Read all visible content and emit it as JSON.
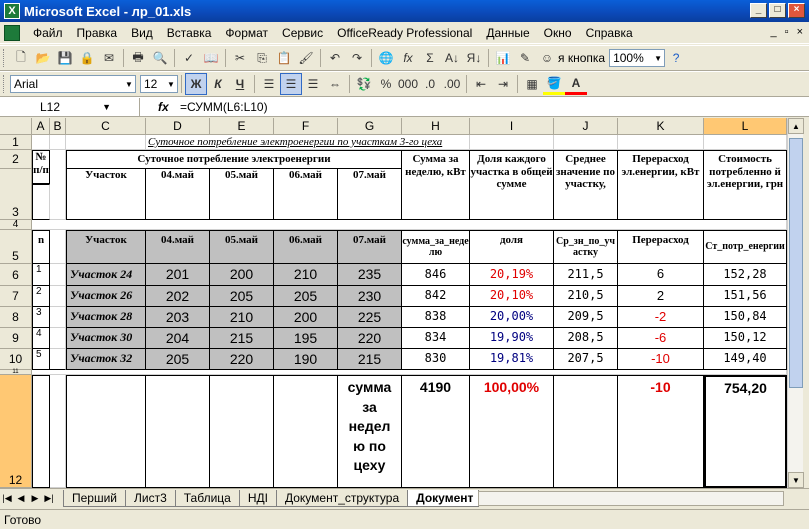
{
  "window": {
    "title": "Microsoft Excel - лр_01.xls"
  },
  "menu": [
    "Файл",
    "Правка",
    "Вид",
    "Вставка",
    "Формат",
    "Сервис",
    "OfficeReady Professional",
    "Данные",
    "Окно",
    "Справка"
  ],
  "toolbar": {
    "smile_label": "я кнопка",
    "zoom": "100%"
  },
  "format_bar": {
    "font": "Arial",
    "size": "12",
    "bold": "Ж",
    "italic": "К",
    "underline": "Ч"
  },
  "formula_bar": {
    "name_box": "L12",
    "fx": "fx",
    "formula": "=СУММ(L6:L10)"
  },
  "columns": [
    "A",
    "B",
    "C",
    "D",
    "E",
    "F",
    "G",
    "H",
    "I",
    "J",
    "K",
    "L"
  ],
  "rows": [
    "1",
    "2",
    "3",
    "4",
    "5",
    "6",
    "7",
    "8",
    "9",
    "10",
    "11",
    "12"
  ],
  "sheet": {
    "title": "Суточное потребление электроенергии по участкам 3-го цеха",
    "hdr": {
      "num": "№ п/п",
      "daily": "Суточное потребление электроенергии",
      "site": "Участок",
      "d1": "04.май",
      "d2": "05.май",
      "d3": "06.май",
      "d4": "07.май",
      "sum": "Сумма за неделю, кВт",
      "share": "Доля каждого участка в общей сумме",
      "avg": "Среднее значение по участку,",
      "over": "Перерасход эл.енергии, кВт",
      "cost": "Стоимость потребленно й эл.енергии, грн"
    },
    "hdr2": {
      "n": "n",
      "site": "Участок",
      "d1": "04.май",
      "d2": "05.май",
      "d3": "06.май",
      "d4": "07.май",
      "sum": "сумма_за_неделю",
      "share": "доля",
      "avg": "Ср_зн_по_участку",
      "over": "Перерасход",
      "cost": "Ст_потр_енергии"
    },
    "data": [
      {
        "n": "1",
        "site": "Участок 24",
        "d1": "201",
        "d2": "200",
        "d3": "210",
        "d4": "235",
        "sum": "846",
        "share": "20,19%",
        "avg": "211,5",
        "over": "6",
        "cost": "152,28"
      },
      {
        "n": "2",
        "site": "Участок 26",
        "d1": "202",
        "d2": "205",
        "d3": "205",
        "d4": "230",
        "sum": "842",
        "share": "20,10%",
        "avg": "210,5",
        "over": "2",
        "cost": "151,56"
      },
      {
        "n": "3",
        "site": "Участок 28",
        "d1": "203",
        "d2": "210",
        "d3": "200",
        "d4": "225",
        "sum": "838",
        "share": "20,00%",
        "avg": "209,5",
        "over": "-2",
        "cost": "150,84"
      },
      {
        "n": "4",
        "site": "Участок 30",
        "d1": "204",
        "d2": "215",
        "d3": "195",
        "d4": "220",
        "sum": "834",
        "share": "19,90%",
        "avg": "208,5",
        "over": "-6",
        "cost": "150,12"
      },
      {
        "n": "5",
        "site": "Участок 32",
        "d1": "205",
        "d2": "220",
        "d3": "190",
        "d4": "215",
        "sum": "830",
        "share": "19,81%",
        "avg": "207,5",
        "over": "-10",
        "cost": "149,40"
      }
    ],
    "totals": {
      "label": "сумма за недел ю по цеху",
      "sum": "4190",
      "share": "100,00%",
      "over": "-10",
      "cost": "754,20"
    }
  },
  "tabs": [
    "Перший",
    "Лист3",
    "Таблица",
    "НДІ",
    "Документ_структура",
    "Документ"
  ],
  "status": "Готово"
}
